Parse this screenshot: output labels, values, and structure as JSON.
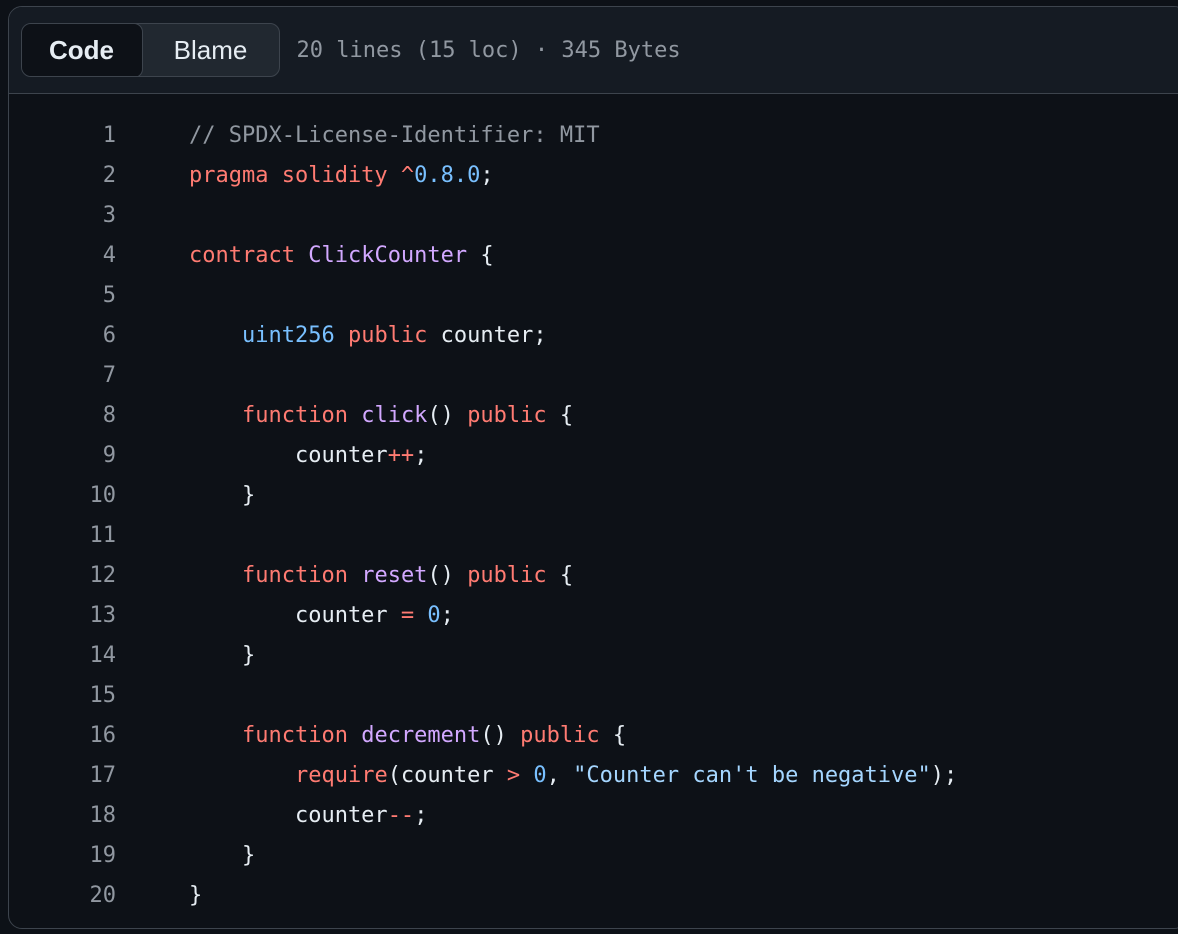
{
  "toolbar": {
    "code_label": "Code",
    "blame_label": "Blame",
    "file_meta": "20 lines (15 loc) · 345 Bytes"
  },
  "syntax_colors": {
    "comment": "#9198a1",
    "keyword": "#ff7b72",
    "constant": "#79c0ff",
    "entity": "#d2a8ff",
    "string": "#a5d6ff",
    "text": "#e6edf3"
  },
  "code_lines": [
    {
      "num": "1",
      "tokens": [
        {
          "t": "// SPDX-License-Identifier: MIT",
          "c": "comment"
        }
      ]
    },
    {
      "num": "2",
      "tokens": [
        {
          "t": "pragma solidity ^",
          "c": "kw"
        },
        {
          "t": "0.8.0",
          "c": "num"
        },
        {
          "t": ";",
          "c": "plain"
        }
      ]
    },
    {
      "num": "3",
      "tokens": []
    },
    {
      "num": "4",
      "tokens": [
        {
          "t": "contract ",
          "c": "kw"
        },
        {
          "t": "ClickCounter",
          "c": "ent"
        },
        {
          "t": " {",
          "c": "plain"
        }
      ]
    },
    {
      "num": "5",
      "tokens": []
    },
    {
      "num": "6",
      "tokens": [
        {
          "t": "    ",
          "c": "plain"
        },
        {
          "t": "uint256",
          "c": "type"
        },
        {
          "t": " ",
          "c": "plain"
        },
        {
          "t": "public",
          "c": "kw"
        },
        {
          "t": " counter;",
          "c": "plain"
        }
      ]
    },
    {
      "num": "7",
      "tokens": []
    },
    {
      "num": "8",
      "tokens": [
        {
          "t": "    ",
          "c": "plain"
        },
        {
          "t": "function",
          "c": "kw"
        },
        {
          "t": " ",
          "c": "plain"
        },
        {
          "t": "click",
          "c": "ent"
        },
        {
          "t": "() ",
          "c": "plain"
        },
        {
          "t": "public",
          "c": "kw"
        },
        {
          "t": " {",
          "c": "plain"
        }
      ]
    },
    {
      "num": "9",
      "tokens": [
        {
          "t": "        counter",
          "c": "plain"
        },
        {
          "t": "++",
          "c": "kw"
        },
        {
          "t": ";",
          "c": "plain"
        }
      ]
    },
    {
      "num": "10",
      "tokens": [
        {
          "t": "    }",
          "c": "plain"
        }
      ]
    },
    {
      "num": "11",
      "tokens": []
    },
    {
      "num": "12",
      "tokens": [
        {
          "t": "    ",
          "c": "plain"
        },
        {
          "t": "function",
          "c": "kw"
        },
        {
          "t": " ",
          "c": "plain"
        },
        {
          "t": "reset",
          "c": "ent"
        },
        {
          "t": "() ",
          "c": "plain"
        },
        {
          "t": "public",
          "c": "kw"
        },
        {
          "t": " {",
          "c": "plain"
        }
      ]
    },
    {
      "num": "13",
      "tokens": [
        {
          "t": "        counter ",
          "c": "plain"
        },
        {
          "t": "=",
          "c": "kw"
        },
        {
          "t": " ",
          "c": "plain"
        },
        {
          "t": "0",
          "c": "num"
        },
        {
          "t": ";",
          "c": "plain"
        }
      ]
    },
    {
      "num": "14",
      "tokens": [
        {
          "t": "    }",
          "c": "plain"
        }
      ]
    },
    {
      "num": "15",
      "tokens": []
    },
    {
      "num": "16",
      "tokens": [
        {
          "t": "    ",
          "c": "plain"
        },
        {
          "t": "function",
          "c": "kw"
        },
        {
          "t": " ",
          "c": "plain"
        },
        {
          "t": "decrement",
          "c": "ent"
        },
        {
          "t": "() ",
          "c": "plain"
        },
        {
          "t": "public",
          "c": "kw"
        },
        {
          "t": " {",
          "c": "plain"
        }
      ]
    },
    {
      "num": "17",
      "tokens": [
        {
          "t": "        ",
          "c": "plain"
        },
        {
          "t": "require",
          "c": "kw"
        },
        {
          "t": "(counter ",
          "c": "plain"
        },
        {
          "t": ">",
          "c": "kw"
        },
        {
          "t": " ",
          "c": "plain"
        },
        {
          "t": "0",
          "c": "num"
        },
        {
          "t": ", ",
          "c": "plain"
        },
        {
          "t": "\"Counter can't be negative\"",
          "c": "str"
        },
        {
          "t": ");",
          "c": "plain"
        }
      ]
    },
    {
      "num": "18",
      "tokens": [
        {
          "t": "        counter",
          "c": "plain"
        },
        {
          "t": "--",
          "c": "kw"
        },
        {
          "t": ";",
          "c": "plain"
        }
      ]
    },
    {
      "num": "19",
      "tokens": [
        {
          "t": "    }",
          "c": "plain"
        }
      ]
    },
    {
      "num": "20",
      "tokens": [
        {
          "t": "}",
          "c": "plain"
        }
      ]
    }
  ]
}
